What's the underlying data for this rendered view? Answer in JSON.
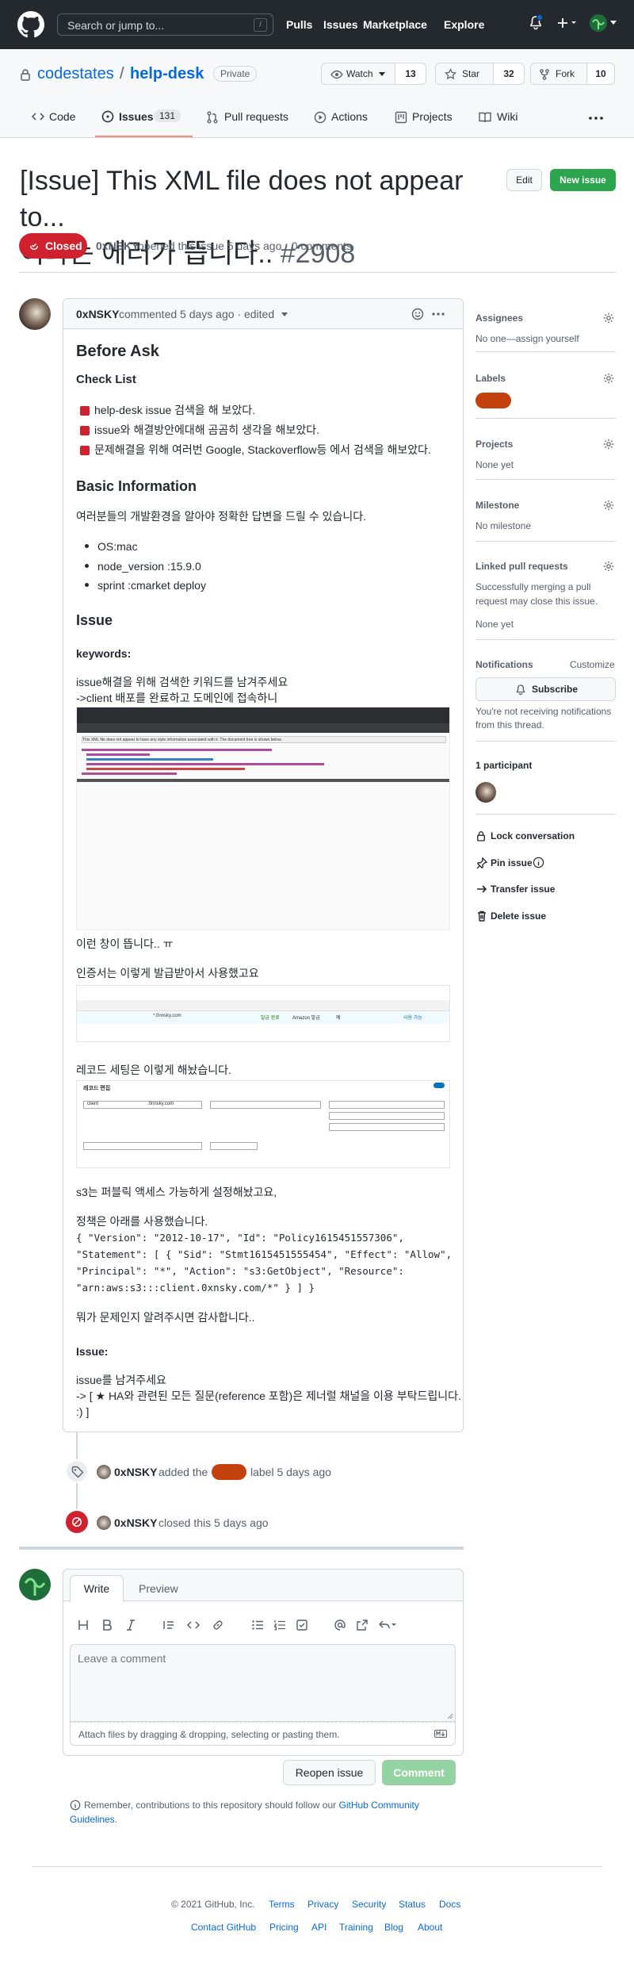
{
  "header": {
    "search_placeholder": "Search or jump to...",
    "slash_key": "/",
    "nav": [
      "Pulls",
      "Issues",
      "Marketplace",
      "Explore"
    ]
  },
  "repo": {
    "owner": "codestates",
    "separator": "/",
    "name": "help-desk",
    "visibility": "Private",
    "watch_label": "Watch",
    "watch_count": "13",
    "star_label": "Star",
    "star_count": "32",
    "fork_label": "Fork",
    "fork_count": "10",
    "tabs": [
      {
        "label": "Code"
      },
      {
        "label": "Issues",
        "count": "131"
      },
      {
        "label": "Pull requests"
      },
      {
        "label": "Actions"
      },
      {
        "label": "Projects"
      },
      {
        "label": "Wiki"
      }
    ]
  },
  "issue": {
    "title_line1": "[Issue] This XML file does not appear to...",
    "title_line2": "이라는 에러가 뜹니다..",
    "number": "#2908",
    "edit_label": "Edit",
    "new_issue_label": "New issue",
    "state": "Closed",
    "author": "0xNSKY",
    "meta": "opened this issue 5 days ago · 0 comments"
  },
  "comment": {
    "author": "0xNSKY",
    "meta": "commented 5 days ago · edited",
    "before_ask": "Before Ask",
    "check_list": "Check List",
    "checks": [
      "help-desk issue 검색을 해 보았다.",
      "issue와 해결방안에대해 곰곰히 생각을 해보았다.",
      "문제해결을 위해 여러번 Google, Stackoverflow등 에서 검색을 해보았다."
    ],
    "basic_info": "Basic Information",
    "basic_desc": "여러분들의 개발환경을 알아야 정확한 답변을 드릴 수 있습니다.",
    "env": [
      "OS:mac",
      "node_version :15.9.0",
      "sprint :cmarket deploy"
    ],
    "issue_h": "Issue",
    "keywords": "keywords:",
    "kw1": "issue해결을 위해 검색한 키워드를 남겨주세요",
    "kw2": "->client 배포를 완료하고 도메인에 접속하니",
    "shot1_caption": "This XML file does not appear to have any style information associated with it. The document tree is shown below.",
    "after_shot1": "이런 창이 뜹니다.. ㅠ",
    "cert_text": "인증서는 이렇게 발급받아서 사용했고요",
    "cert_domain": "*.0nnsky.com",
    "cert_status": "발급 완료",
    "cert_type": "Amazon 발급",
    "cert_in_use": "예",
    "cert_renew": "사용 가능",
    "record_text": "레코드 세팅은 이렇게 해놨습니다.",
    "record_title": "레코드 편집",
    "record_name": "client",
    "record_domain": ".0nnsky.com",
    "s3_text": "s3는 퍼블릭 액세스 가능하게 설정해놨고요,",
    "policy_text": "정책은 아래를 사용했습니다.",
    "policy_lines": [
      "{ \"Version\": \"2012-10-17\", \"Id\": \"Policy1615451557306\",",
      "\"Statement\": [ { \"Sid\": \"Stmt1615451555454\", \"Effect\": \"Allow\",",
      "\"Principal\": \"*\", \"Action\": \"s3:GetObject\", \"Resource\":",
      "\"arn:aws:s3:::client.0xnsky.com/*\" } ] }"
    ],
    "thanks": "뭐가 문제인지 알려주시면 감사합니다..",
    "issue_label": "Issue:",
    "leave1": "issue를 남겨주세요",
    "leave2": "-> [ ★ HA와 관련된 모든 질문(reference 포함)은 제너럴 채널을 이용 부탁드립니다.",
    "leave3": ":) ]"
  },
  "timeline": {
    "label_event": {
      "author": "0xNSKY",
      "action": "added the",
      "after": "label 5 days ago"
    },
    "close_event": {
      "author": "0xNSKY",
      "text": "closed this 5 days ago"
    }
  },
  "composer": {
    "write_tab": "Write",
    "preview_tab": "Preview",
    "placeholder": "Leave a comment",
    "attach_text": "Attach files by dragging & dropping, selecting or pasting them.",
    "reopen_label": "Reopen issue",
    "comment_label": "Comment",
    "guideline_prefix": "Remember, contributions to this repository should follow our",
    "guideline_link": "GitHub Community",
    "guideline_link2": "Guidelines",
    "guideline_suffix": "."
  },
  "sidebar": {
    "assignees_h": "Assignees",
    "assignees_t": "No one—assign yourself",
    "labels_h": "Labels",
    "projects_h": "Projects",
    "projects_t": "None yet",
    "milestone_h": "Milestone",
    "milestone_t": "No milestone",
    "linked_h": "Linked pull requests",
    "linked_t1": "Successfully merging a pull",
    "linked_t2": "request may close this issue.",
    "linked_t3": "None yet",
    "notif_h": "Notifications",
    "customize": "Customize",
    "subscribe": "Subscribe",
    "notif_t1": "You're not receiving notifications",
    "notif_t2": "from this thread.",
    "participants": "1 participant",
    "lock": "Lock conversation",
    "pin": "Pin issue",
    "transfer": "Transfer issue",
    "delete": "Delete issue"
  },
  "footer": {
    "copyright": "© 2021 GitHub, Inc.",
    "row1": [
      "Terms",
      "Privacy",
      "Security",
      "Status",
      "Docs"
    ],
    "row2": [
      "Contact GitHub",
      "Pricing",
      "API",
      "Training",
      "Blog",
      "About"
    ]
  },
  "colors": {
    "closed": "#cf222e",
    "label": "#c2410c",
    "green": "#2da44e",
    "link": "#0969da"
  }
}
